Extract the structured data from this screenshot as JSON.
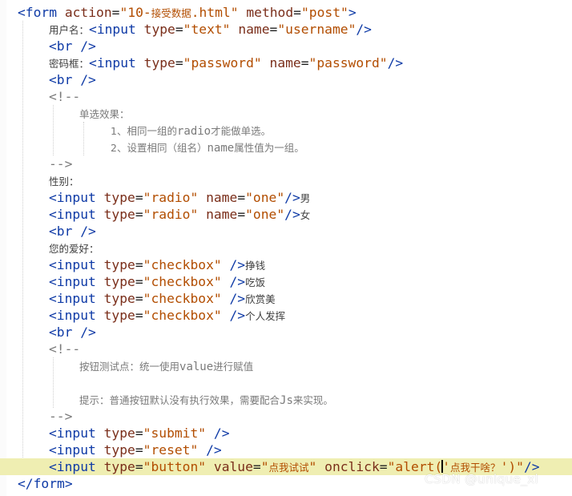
{
  "editor": {
    "lines": [
      {
        "indent": 0,
        "tokens": [
          [
            "tag",
            "<form "
          ],
          [
            "attr",
            "action"
          ],
          [
            "eq",
            "="
          ],
          [
            "str",
            "\"10-"
          ],
          [
            "cjk-str",
            "接受数据"
          ],
          [
            "str",
            ".html\""
          ],
          [
            "plain",
            " "
          ],
          [
            "attr",
            "method"
          ],
          [
            "eq",
            "="
          ],
          [
            "str",
            "\"post\""
          ],
          [
            "tag",
            ">"
          ]
        ]
      },
      {
        "indent": 1,
        "tokens": [
          [
            "cjk",
            "用户名："
          ],
          [
            "tag",
            "<input "
          ],
          [
            "attr",
            "type"
          ],
          [
            "eq",
            "="
          ],
          [
            "str",
            "\"text\""
          ],
          [
            "plain",
            " "
          ],
          [
            "attr",
            "name"
          ],
          [
            "eq",
            "="
          ],
          [
            "str",
            "\"username\""
          ],
          [
            "tag",
            "/>"
          ]
        ]
      },
      {
        "indent": 1,
        "tokens": [
          [
            "tag",
            "<br />"
          ]
        ]
      },
      {
        "indent": 1,
        "tokens": [
          [
            "cjk",
            "密码框："
          ],
          [
            "tag",
            "<input "
          ],
          [
            "attr",
            "type"
          ],
          [
            "eq",
            "="
          ],
          [
            "str",
            "\"password\""
          ],
          [
            "plain",
            " "
          ],
          [
            "attr",
            "name"
          ],
          [
            "eq",
            "="
          ],
          [
            "str",
            "\"password\""
          ],
          [
            "tag",
            "/>"
          ]
        ]
      },
      {
        "indent": 1,
        "tokens": [
          [
            "tag",
            "<br />"
          ]
        ]
      },
      {
        "indent": 1,
        "tokens": [
          [
            "cmt",
            "<!--"
          ]
        ]
      },
      {
        "indent": 2,
        "tokens": [
          [
            "cjk-gray",
            "单选效果："
          ]
        ]
      },
      {
        "indent": 3,
        "tokens": [
          [
            "cjk-gray",
            "1、相同一组的"
          ],
          [
            "mono-gray",
            "radio"
          ],
          [
            "cjk-gray",
            "才能做单选。"
          ]
        ]
      },
      {
        "indent": 3,
        "tokens": [
          [
            "cjk-gray",
            "2、设置相同（组名）"
          ],
          [
            "mono-gray",
            "name"
          ],
          [
            "cjk-gray",
            "属性值为一组。"
          ]
        ]
      },
      {
        "indent": 1,
        "tokens": [
          [
            "cmt",
            "-->"
          ]
        ]
      },
      {
        "indent": 1,
        "tokens": [
          [
            "cjk",
            "性别："
          ]
        ]
      },
      {
        "indent": 1,
        "tokens": [
          [
            "tag",
            "<input "
          ],
          [
            "attr",
            "type"
          ],
          [
            "eq",
            "="
          ],
          [
            "str",
            "\"radio\""
          ],
          [
            "plain",
            " "
          ],
          [
            "attr",
            "name"
          ],
          [
            "eq",
            "="
          ],
          [
            "str",
            "\"one\""
          ],
          [
            "tag",
            "/>"
          ],
          [
            "cjk",
            "男"
          ]
        ]
      },
      {
        "indent": 1,
        "tokens": [
          [
            "tag",
            "<input "
          ],
          [
            "attr",
            "type"
          ],
          [
            "eq",
            "="
          ],
          [
            "str",
            "\"radio\""
          ],
          [
            "plain",
            " "
          ],
          [
            "attr",
            "name"
          ],
          [
            "eq",
            "="
          ],
          [
            "str",
            "\"one\""
          ],
          [
            "tag",
            "/>"
          ],
          [
            "cjk",
            "女"
          ]
        ]
      },
      {
        "indent": 1,
        "tokens": [
          [
            "tag",
            "<br />"
          ]
        ]
      },
      {
        "indent": 1,
        "tokens": [
          [
            "cjk",
            "您的爱好："
          ]
        ]
      },
      {
        "indent": 1,
        "tokens": [
          [
            "tag",
            "<input "
          ],
          [
            "attr",
            "type"
          ],
          [
            "eq",
            "="
          ],
          [
            "str",
            "\"checkbox\""
          ],
          [
            "plain",
            " "
          ],
          [
            "tag",
            "/>"
          ],
          [
            "cjk",
            "挣钱"
          ]
        ]
      },
      {
        "indent": 1,
        "tokens": [
          [
            "tag",
            "<input "
          ],
          [
            "attr",
            "type"
          ],
          [
            "eq",
            "="
          ],
          [
            "str",
            "\"checkbox\""
          ],
          [
            "plain",
            " "
          ],
          [
            "tag",
            "/>"
          ],
          [
            "cjk",
            "吃饭"
          ]
        ]
      },
      {
        "indent": 1,
        "tokens": [
          [
            "tag",
            "<input "
          ],
          [
            "attr",
            "type"
          ],
          [
            "eq",
            "="
          ],
          [
            "str",
            "\"checkbox\""
          ],
          [
            "plain",
            " "
          ],
          [
            "tag",
            "/>"
          ],
          [
            "cjk",
            "欣赏美"
          ]
        ]
      },
      {
        "indent": 1,
        "tokens": [
          [
            "tag",
            "<input "
          ],
          [
            "attr",
            "type"
          ],
          [
            "eq",
            "="
          ],
          [
            "str",
            "\"checkbox\""
          ],
          [
            "plain",
            " "
          ],
          [
            "tag",
            "/>"
          ],
          [
            "cjk",
            "个人发挥"
          ]
        ]
      },
      {
        "indent": 1,
        "tokens": [
          [
            "tag",
            "<br />"
          ]
        ]
      },
      {
        "indent": 1,
        "tokens": [
          [
            "cmt",
            "<!--"
          ]
        ]
      },
      {
        "indent": 2,
        "tokens": [
          [
            "cjk-gray",
            "按钮测试点：统一使用"
          ],
          [
            "mono-gray",
            "value"
          ],
          [
            "cjk-gray",
            "进行赋值"
          ]
        ]
      },
      {
        "indent": 2,
        "tokens": []
      },
      {
        "indent": 2,
        "tokens": [
          [
            "cjk-gray",
            "提示：普通按钮默认没有执行效果，需要配合"
          ],
          [
            "mono-gray",
            "Js"
          ],
          [
            "cjk-gray",
            "来实现。"
          ]
        ]
      },
      {
        "indent": 1,
        "tokens": [
          [
            "cmt",
            "-->"
          ]
        ]
      },
      {
        "indent": 1,
        "tokens": [
          [
            "tag",
            "<input "
          ],
          [
            "attr",
            "type"
          ],
          [
            "eq",
            "="
          ],
          [
            "str",
            "\"submit\""
          ],
          [
            "plain",
            " "
          ],
          [
            "tag",
            "/>"
          ]
        ]
      },
      {
        "indent": 1,
        "tokens": [
          [
            "tag",
            "<input "
          ],
          [
            "attr",
            "type"
          ],
          [
            "eq",
            "="
          ],
          [
            "str",
            "\"reset\""
          ],
          [
            "plain",
            " "
          ],
          [
            "tag",
            "/>"
          ]
        ]
      },
      {
        "indent": 1,
        "highlight": true,
        "tokens": [
          [
            "tag",
            "<input "
          ],
          [
            "attr",
            "type"
          ],
          [
            "eq",
            "="
          ],
          [
            "str",
            "\"button\""
          ],
          [
            "plain",
            " "
          ],
          [
            "attr",
            "value"
          ],
          [
            "eq",
            "="
          ],
          [
            "str",
            "\""
          ],
          [
            "cjk-str",
            "点我试试"
          ],
          [
            "str",
            "\""
          ],
          [
            "plain",
            " "
          ],
          [
            "attr",
            "onclick"
          ],
          [
            "eq",
            "="
          ],
          [
            "str",
            "\"alert("
          ],
          [
            "caret",
            ""
          ],
          [
            "str",
            "'"
          ],
          [
            "cjk-str",
            "点我干啥？"
          ],
          [
            "str",
            "')\""
          ],
          [
            "tag",
            "/>"
          ]
        ]
      },
      {
        "indent": 0,
        "tokens": [
          [
            "tag",
            "</form>"
          ]
        ]
      }
    ]
  },
  "watermark": "CSDN @unique_xl"
}
